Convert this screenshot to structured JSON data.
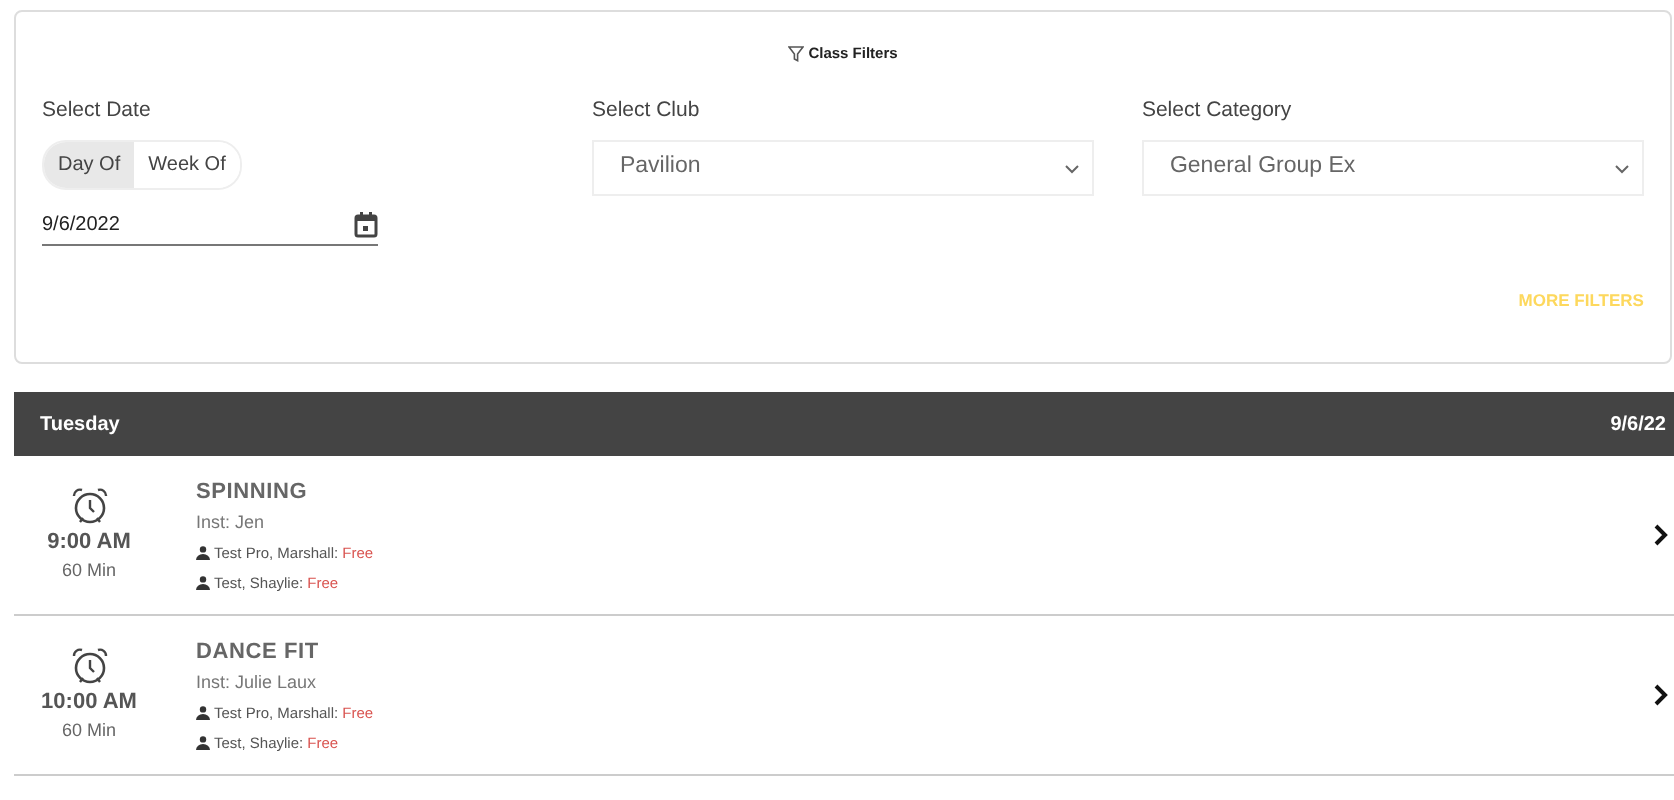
{
  "filters": {
    "title": "Class Filters",
    "date_label": "Select Date",
    "date_modes": [
      {
        "label": "Day Of",
        "selected": true
      },
      {
        "label": "Week Of",
        "selected": false
      }
    ],
    "date_value": "9/6/2022",
    "club_label": "Select Club",
    "club_value": "Pavilion",
    "category_label": "Select Category",
    "category_value": "General Group Ex",
    "more_filters": "MORE FILTERS"
  },
  "day": {
    "name": "Tuesday",
    "date": "9/6/22"
  },
  "classes": [
    {
      "time": "9:00 AM",
      "duration": "60 Min",
      "name": "SPINNING",
      "instructor": "Inst: Jen",
      "slots": [
        {
          "person": "Test Pro, Marshall:",
          "status": "Free"
        },
        {
          "person": "Test, Shaylie:",
          "status": "Free"
        }
      ]
    },
    {
      "time": "10:00 AM",
      "duration": "60 Min",
      "name": "DANCE FIT",
      "instructor": "Inst: Julie Laux",
      "slots": [
        {
          "person": "Test Pro, Marshall:",
          "status": "Free"
        },
        {
          "person": "Test, Shaylie:",
          "status": "Free"
        }
      ]
    }
  ]
}
